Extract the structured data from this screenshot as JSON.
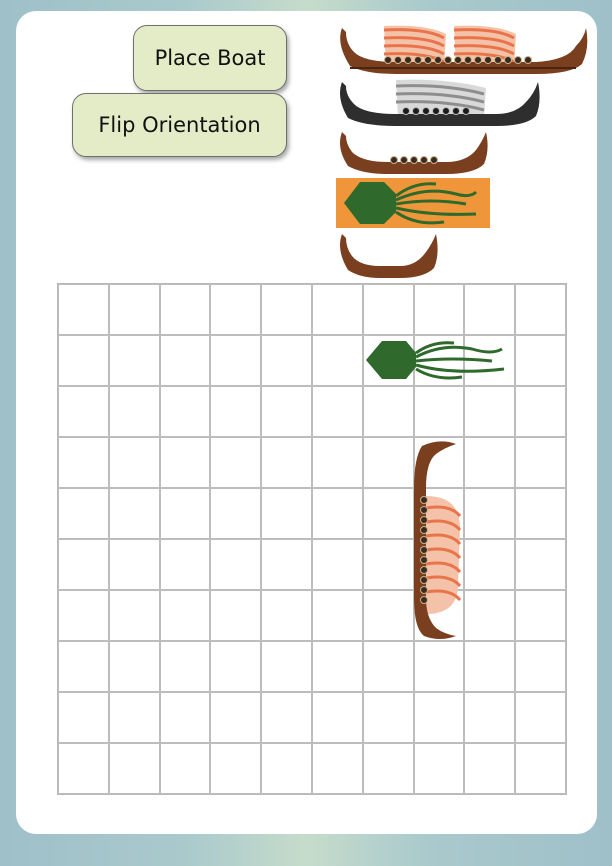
{
  "controls": {
    "place_label": "Place Boat",
    "flip_label": "Flip Orientation"
  },
  "tray": [
    {
      "name": "longship-five-sail",
      "icon": "viking-longship-icon",
      "sail_color": "#e9744a"
    },
    {
      "name": "longship-grey",
      "icon": "viking-longship-icon",
      "sail_color": "#9a9a9a"
    },
    {
      "name": "longship-three",
      "icon": "viking-longship-icon",
      "sail_color": "#e9744a"
    },
    {
      "name": "kraken",
      "icon": "kraken-icon",
      "background": "#f0963a",
      "body_color": "#2f6a2c"
    },
    {
      "name": "longship-two",
      "icon": "viking-longship-icon",
      "sail_color": "#e9744a"
    }
  ],
  "board": {
    "rows": 10,
    "cols": 10,
    "placed": [
      {
        "piece": "kraken",
        "orientation": "horizontal",
        "row": 2,
        "col": 7,
        "length": 3
      },
      {
        "piece": "longship",
        "orientation": "vertical",
        "row": 4,
        "col": 8,
        "length": 4
      }
    ]
  },
  "colors": {
    "hull": "#7a3f1e",
    "sail_orange": "#e9744a",
    "kraken_green": "#2f6a2c",
    "kraken_bg": "#f0963a",
    "button_bg": "#e3ecc6"
  }
}
